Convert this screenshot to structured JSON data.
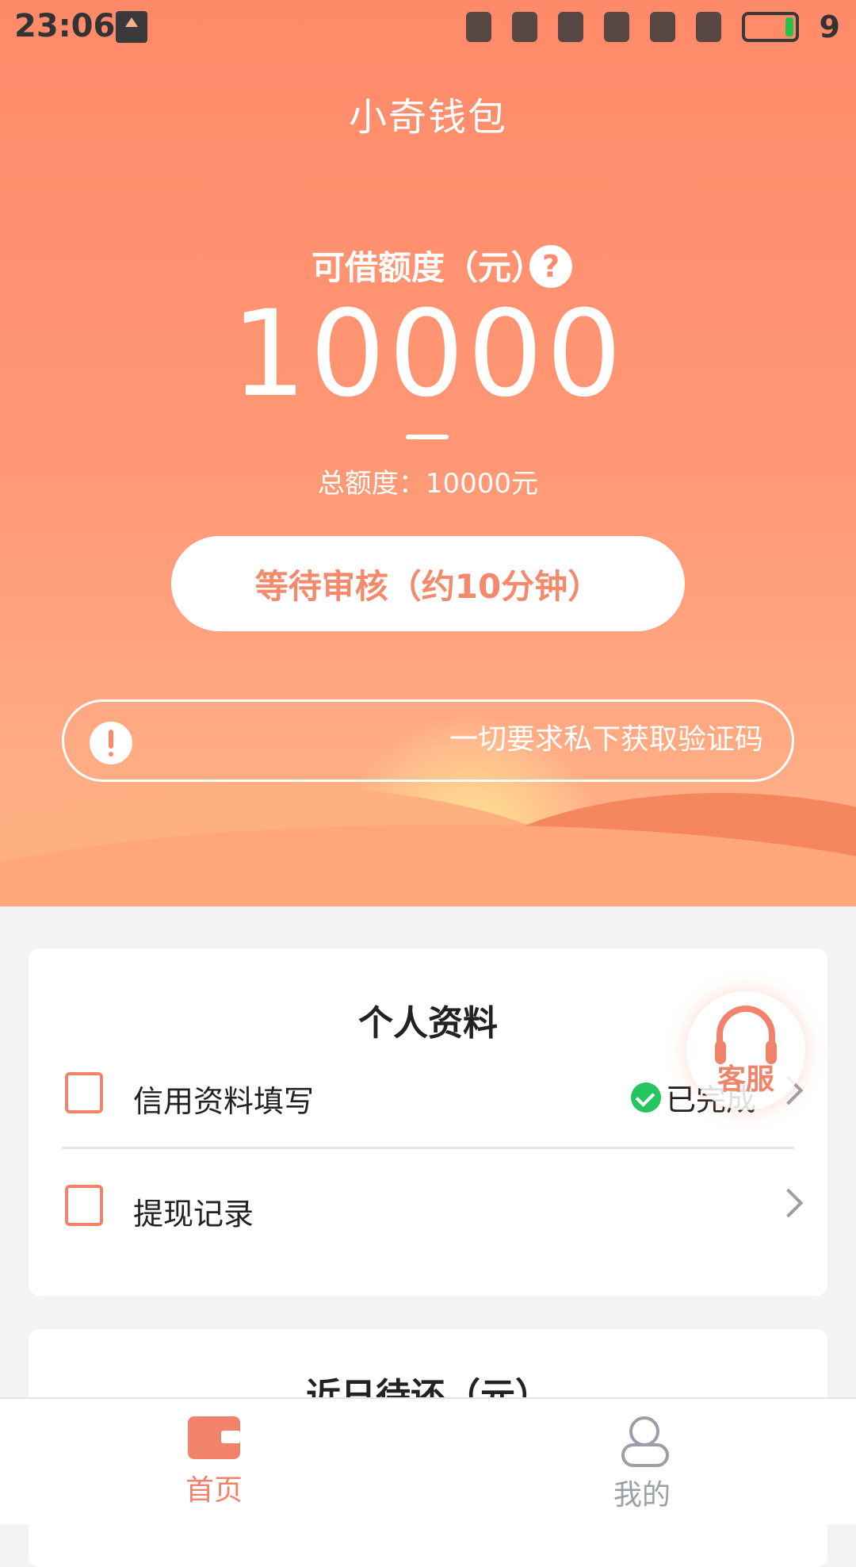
{
  "status_bar": {
    "time": "23:06",
    "battery_level_text": "9",
    "icons": [
      "upload-icon",
      "vibrate-icon",
      "alarm-icon",
      "wifi-icon",
      "signal-icon",
      "4g-signal-icon",
      "charging-icon",
      "battery-icon"
    ]
  },
  "header": {
    "title": "小奇钱包"
  },
  "credit": {
    "label": "可借额度（元）",
    "help_icon_text": "?",
    "amount": "10000",
    "total_text": "总额度：10000元"
  },
  "apply_button": {
    "label": "等待审核（约10分钟）"
  },
  "notice": {
    "text": "一切要求私下获取验证码"
  },
  "profile_card": {
    "title": "个人资料",
    "rows": [
      {
        "label": "信用资料填写",
        "status": "已完成"
      },
      {
        "label": "提现记录"
      }
    ]
  },
  "repay_card": {
    "title": "近日待还（元）"
  },
  "customer_service": {
    "label": "客服"
  },
  "bottom_nav": {
    "items": [
      {
        "label": "首页",
        "icon": "wallet-icon",
        "active": true
      },
      {
        "label": "我的",
        "icon": "user-icon",
        "active": false
      }
    ]
  },
  "colors": {
    "accent": "#f0836a",
    "hero_top": "#ff8a6a",
    "hero_bottom": "#ffb58a",
    "success": "#22c55e"
  }
}
